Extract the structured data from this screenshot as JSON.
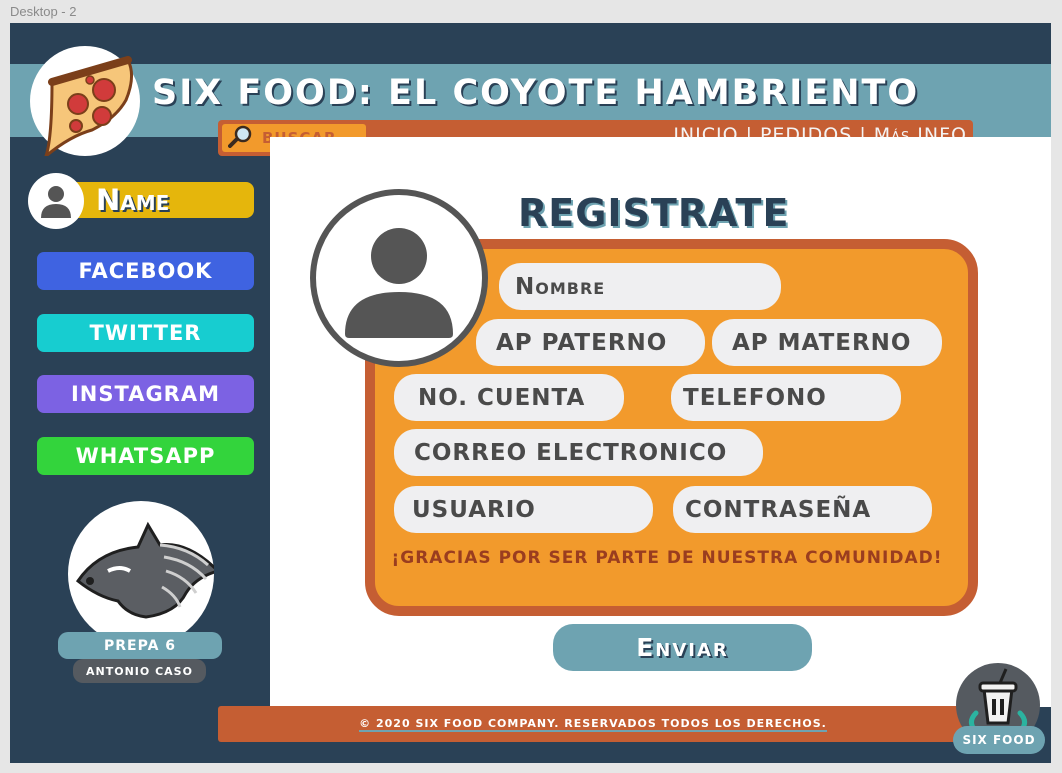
{
  "canvas": {
    "label": "Desktop - 2"
  },
  "header": {
    "title": "SIX FOOD: EL COYOTE HAMBRIENTO"
  },
  "nav": {
    "search_label": "BUSCAR",
    "links": [
      "INICIO",
      "PEDIDOS",
      "Más INFO"
    ],
    "separator": "|"
  },
  "sidebar": {
    "user_name": "Name",
    "social": [
      {
        "label": "FACEBOOK",
        "color": "#3f63e1"
      },
      {
        "label": "TWITTER",
        "color": "#17cdd0"
      },
      {
        "label": "INSTAGRAM",
        "color": "#7c62e3"
      },
      {
        "label": "WHATSAPP",
        "color": "#33d43c"
      }
    ],
    "school": "PREPA 6",
    "school_sub": "ANTONIO CASO"
  },
  "form": {
    "title": "REGISTRATE",
    "fields": {
      "nombre": "Nombre",
      "ap_paterno": "AP PATERNO",
      "ap_materno": "AP MATERNO",
      "cuenta": "NO. CUENTA",
      "telefono": "TELEFONO",
      "correo": "CORREO ELECTRONICO",
      "usuario": "USUARIO",
      "contrasena": "CONTRASEÑA"
    },
    "thanks": "¡GRACIAS POR SER PARTE DE NUESTRA COMUNIDAD!",
    "submit": "Enviar"
  },
  "footer": {
    "copyright": "© 2020 SIX FOOD COMPANY. RESERVADOS TODOS LOS DERECHOS."
  },
  "brand": {
    "label": "SIX FOOD"
  },
  "colors": {
    "navy": "#2a4156",
    "teal": "#6ea3b1",
    "rust": "#c55e33",
    "orange": "#f29a2c",
    "yellow": "#e5b60c"
  }
}
